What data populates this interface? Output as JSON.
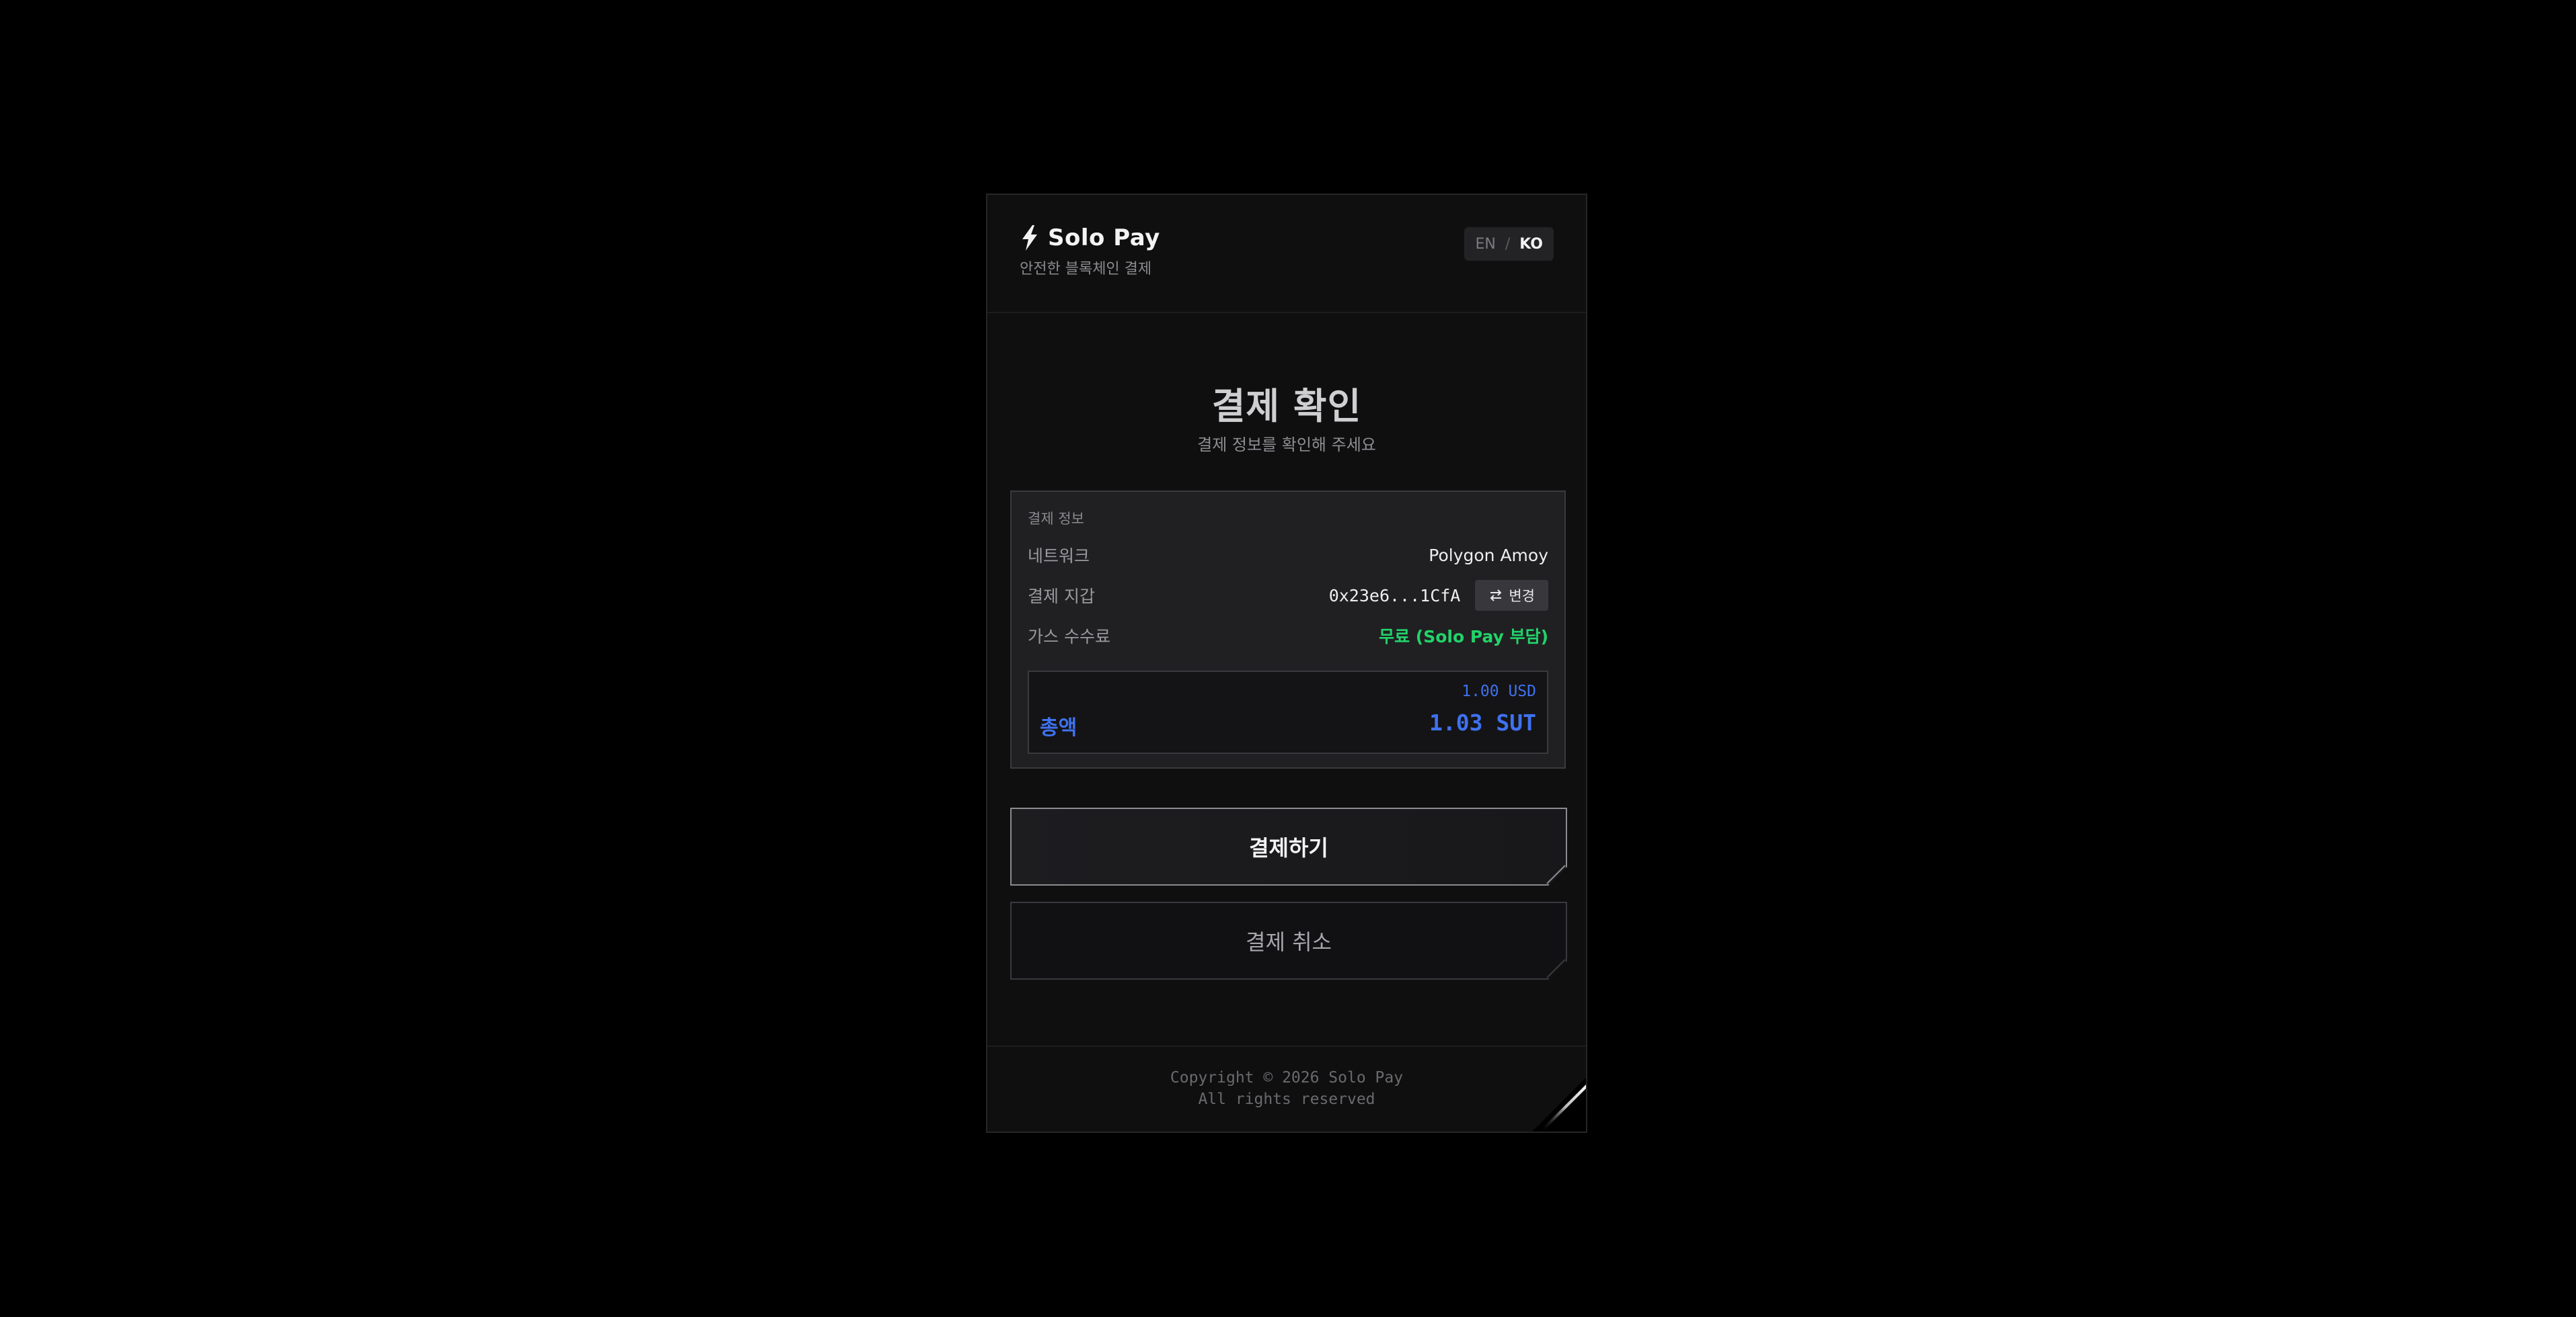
{
  "header": {
    "brand_name": "Solo Pay",
    "brand_subtitle": "안전한 블록체인 결제",
    "lang_en": "EN",
    "lang_separator": "/",
    "lang_ko": "KO"
  },
  "main": {
    "title": "결제 확인",
    "subtitle": "결제 정보를 확인해 주세요"
  },
  "info": {
    "heading": "결제 정보",
    "network_label": "네트워크",
    "network_value": "Polygon Amoy",
    "wallet_label": "결제 지갑",
    "wallet_value": "0x23e6...1CfA",
    "change_label": "변경",
    "gas_label": "가스 수수료",
    "gas_value": "무료 (Solo Pay 부담)",
    "total_usd": "1.00 USD",
    "total_label": "총액",
    "total_amount": "1.03 SUT"
  },
  "actions": {
    "pay_label": "결제하기",
    "cancel_label": "결제 취소"
  },
  "footer": {
    "copyright": "Copyright © 2026 Solo Pay",
    "rights": "All rights reserved"
  },
  "icons": {
    "brand": "lightning-bolt-icon",
    "change": "swap-arrows-icon"
  },
  "colors": {
    "accent_blue": "#3f72f0",
    "free_green": "#22d36a",
    "background": "#000000",
    "card": "#0f0f10"
  }
}
